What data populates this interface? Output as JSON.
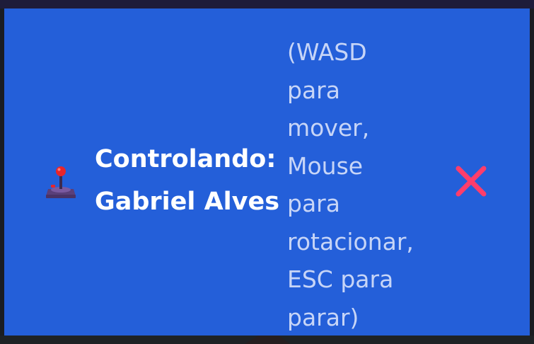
{
  "banner": {
    "icon": "joystick-icon",
    "title_label": "Controlando:",
    "controlled_name": "Gabriel Alves",
    "hint_lines": [
      "(WASD",
      "para",
      "mover,",
      "Mouse",
      "para",
      "rotacionar,",
      "ESC para",
      "parar)"
    ],
    "close_icon": "close-icon"
  },
  "colors": {
    "banner_bg": "#245fd9",
    "title_text": "#ffffff",
    "hint_text": "#c7d5f7",
    "close": "#ff3d6b"
  }
}
